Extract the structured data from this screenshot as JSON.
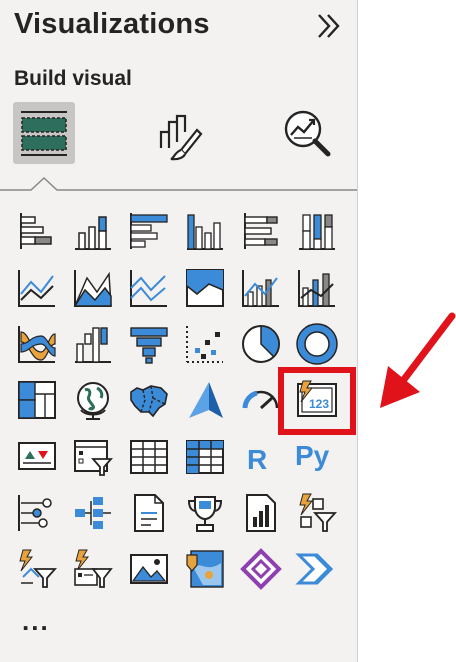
{
  "pane": {
    "title": "Visualizations",
    "subtitle": "Build visual",
    "collapse_icon": "double-chevron-right-icon",
    "more_label": "...",
    "modes": [
      {
        "name": "build-visual",
        "icon": "fields-grid-icon",
        "selected": true
      },
      {
        "name": "format-visual",
        "icon": "paintbrush-chart-icon",
        "selected": false
      },
      {
        "name": "analytics",
        "icon": "magnifier-chart-icon",
        "selected": false
      }
    ]
  },
  "visuals": [
    [
      "stacked-bar-chart",
      "stacked-column-chart",
      "clustered-bar-chart",
      "clustered-column-chart",
      "100-stacked-bar-chart",
      "100-stacked-column-chart"
    ],
    [
      "line-chart",
      "area-chart",
      "stacked-area-chart",
      "100-stacked-area-chart",
      "line-and-stacked-column-chart",
      "line-and-clustered-column-chart"
    ],
    [
      "ribbon-chart",
      "waterfall-chart",
      "funnel-chart",
      "scatter-chart",
      "pie-chart",
      "donut-chart"
    ],
    [
      "treemap",
      "map",
      "filled-map",
      "azure-map",
      "gauge",
      "card"
    ],
    [
      "kpi",
      "slicer",
      "table",
      "matrix",
      "r-script-visual",
      "python-visual"
    ],
    [
      "key-influencers",
      "decomposition-tree",
      "smart-narrative",
      "goals",
      "paginated-report",
      "qa"
    ],
    [
      "qa-narrative",
      "qa-filter",
      "image",
      "arcgis-map",
      "power-apps",
      "power-automate"
    ]
  ],
  "glyphs": {
    "r_label": "R",
    "py_label": "Py",
    "card_value": "123"
  },
  "highlight": {
    "target": "card",
    "color": "#e0121a"
  },
  "colors": {
    "accent": "#3c8bd9",
    "dark": "#252423",
    "gray": "#8a8886",
    "teal": "#2e6e5c",
    "orange": "#e8a33d"
  }
}
